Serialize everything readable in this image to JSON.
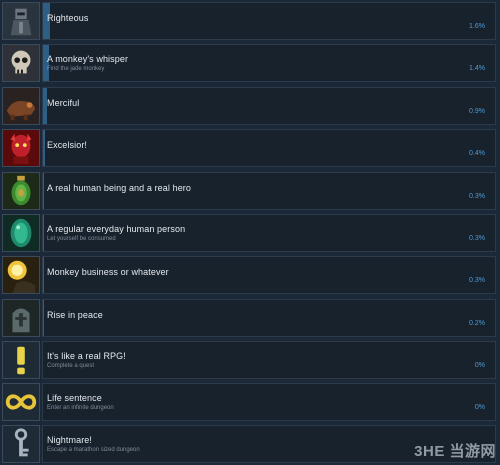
{
  "achievements": [
    {
      "name": "Righteous",
      "description": "",
      "percent": "1.6%",
      "progress": 1.6,
      "icon": "armored-knight-icon",
      "color": "#3a4855"
    },
    {
      "name": "A monkey's whisper",
      "description": "Find the jade monkey",
      "percent": "1.4%",
      "progress": 1.4,
      "icon": "skull-icon",
      "color": "#4a4f55"
    },
    {
      "name": "Merciful",
      "description": "",
      "percent": "0.9%",
      "progress": 0.9,
      "icon": "fallen-creature-icon",
      "color": "#5a3422"
    },
    {
      "name": "Excelsior!",
      "description": "",
      "percent": "0.4%",
      "progress": 0.4,
      "icon": "red-demon-icon",
      "color": "#8a1616"
    },
    {
      "name": "A real human being and a real hero",
      "description": "",
      "percent": "0.3%",
      "progress": 0.3,
      "icon": "green-ornament-icon",
      "color": "#3d6a28"
    },
    {
      "name": "A regular everyday human person",
      "description": "Let yourself be consumed",
      "percent": "0.3%",
      "progress": 0.3,
      "icon": "green-gem-icon",
      "color": "#1f6a56"
    },
    {
      "name": "Monkey business or whatever",
      "description": "",
      "percent": "0.3%",
      "progress": 0.3,
      "icon": "glowing-orb-icon",
      "color": "#6b5412"
    },
    {
      "name": "Rise in peace",
      "description": "",
      "percent": "0.2%",
      "progress": 0.2,
      "icon": "tombstone-icon",
      "color": "#3c4848"
    },
    {
      "name": "It's like a real RPG!",
      "description": "Complete a quest",
      "percent": "0%",
      "progress": 0,
      "icon": "exclamation-icon",
      "color": "#6e6a22"
    },
    {
      "name": "Life sentence",
      "description": "Enter an infinite dungeon",
      "percent": "0%",
      "progress": 0,
      "icon": "infinity-icon",
      "color": "#6a5a18"
    },
    {
      "name": "Nightmare!",
      "description": "Escape a marathon sized dungeon",
      "percent": "0%",
      "progress": 0,
      "icon": "chain-key-icon",
      "color": "#3a4a5a"
    }
  ],
  "watermark": "3HE 当游网"
}
